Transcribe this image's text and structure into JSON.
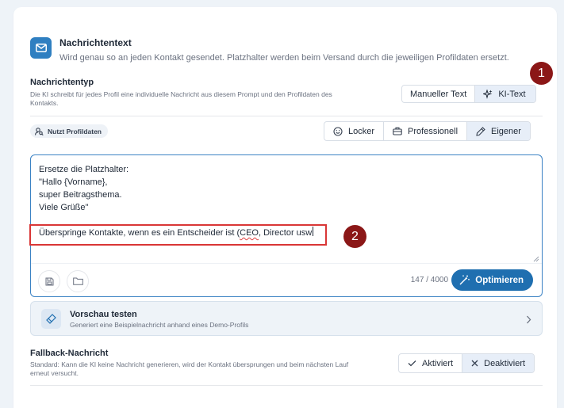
{
  "header": {
    "title": "Nachrichtentext",
    "subtitle": "Wird genau so an jeden Kontakt gesendet. Platzhalter werden beim Versand durch die jeweiligen Profildaten ersetzt.",
    "icon": "mail-icon"
  },
  "message_type": {
    "title": "Nachrichtentyp",
    "description_line1": "Die KI schreibt für jedes Profil eine individuelle Nachricht aus diesem Prompt und den Profildaten des",
    "description_line2": "Kontakts.",
    "options": [
      {
        "label": "Manueller Text",
        "active": false
      },
      {
        "label": "KI-Text",
        "active": true,
        "icon": "sparkles-icon"
      }
    ]
  },
  "profile_pill": {
    "label": "Nutzt Profildaten",
    "icon": "user-search-icon"
  },
  "tone": {
    "options": [
      {
        "label": "Locker",
        "icon": "smile-icon",
        "active": false
      },
      {
        "label": "Professionell",
        "icon": "briefcase-icon",
        "active": false
      },
      {
        "label": "Eigener",
        "icon": "pen-icon",
        "active": true
      }
    ]
  },
  "editor": {
    "line1": "Ersetze die Platzhalter:",
    "line2": "\"Hallo {Vorname},",
    "line3": "super Beitragsthema.",
    "line4": "Viele Grüße\"",
    "line6_prefix": "Überspringe Kontakte, wenn es ein Entscheider ist (",
    "line6_underlined": "CEO",
    "line6_suffix": ", Director usw",
    "counter": "147 / 4000",
    "optimize_label": "Optimieren"
  },
  "annotations": {
    "marker1": "1",
    "marker2": "2"
  },
  "preview": {
    "title": "Vorschau testen",
    "subtitle": "Generiert eine Beispielnachricht anhand eines Demo-Profils"
  },
  "fallback": {
    "title": "Fallback-Nachricht",
    "description_line1": "Standard: Kann die KI keine Nachricht generieren, wird der Kontakt übersprungen und beim nächsten Lauf",
    "description_line2": "erneut versucht.",
    "options": [
      {
        "label": "Aktiviert",
        "icon": "check-icon",
        "active": false
      },
      {
        "label": "Deaktiviert",
        "icon": "x-icon",
        "active": true
      }
    ]
  },
  "colors": {
    "accent": "#1f6fb0",
    "marker": "#8b1717",
    "highlight": "#d93636"
  }
}
